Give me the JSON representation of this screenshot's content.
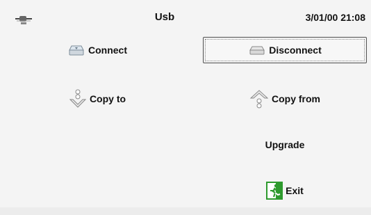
{
  "header": {
    "title": "Usb",
    "datetime": "3/01/00 21:08",
    "status_icon": "usb-plug-icon"
  },
  "buttons": {
    "connect": {
      "label": "Connect",
      "icon": "connect-drive-icon"
    },
    "disconnect": {
      "label": "Disconnect",
      "icon": "disconnect-drive-icon"
    },
    "copy_to": {
      "label": "Copy to",
      "icon": "copy-to-arrow-icon"
    },
    "copy_from": {
      "label": "Copy from",
      "icon": "copy-from-arrow-icon"
    },
    "upgrade": {
      "label": "Upgrade"
    },
    "exit": {
      "label": "Exit",
      "icon": "exit-running-man-icon"
    }
  },
  "colors": {
    "background": "#f4f4f4",
    "exit_icon_green": "#2e9a2e",
    "focus_border": "#555555"
  }
}
